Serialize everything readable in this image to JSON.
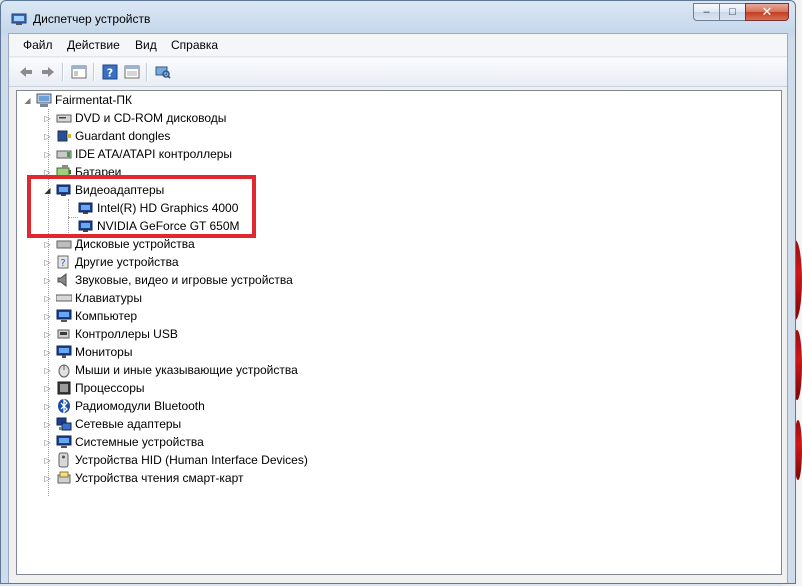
{
  "window": {
    "title": "Диспетчер устройств",
    "icon": "device-manager-icon",
    "caption_buttons": {
      "minimize": "–",
      "maximize": "□",
      "close": "✕"
    }
  },
  "menu": {
    "items": [
      "Файл",
      "Действие",
      "Вид",
      "Справка"
    ]
  },
  "toolbar": {
    "buttons": [
      "back-arrow-icon",
      "forward-arrow-icon",
      "properties-pane-icon",
      "help-icon",
      "show-hide-console-tree-icon",
      "scan-hardware-icon"
    ]
  },
  "tree": {
    "root": {
      "label": "Fairmentat-ПК",
      "expanded": true
    },
    "categories": [
      {
        "label": "DVD и CD-ROM дисководы",
        "icon": "dvd-drive-icon",
        "expanded": false
      },
      {
        "label": "Guardant dongles",
        "icon": "dongle-icon",
        "expanded": false
      },
      {
        "label": "IDE ATA/ATAPI контроллеры",
        "icon": "ide-controller-icon",
        "expanded": false
      },
      {
        "label": "Батареи",
        "icon": "battery-icon",
        "expanded": false
      },
      {
        "label": "Видеоадаптеры",
        "icon": "display-adapter-icon",
        "expanded": true,
        "children": [
          {
            "label": "Intel(R) HD Graphics 4000",
            "icon": "display-adapter-icon"
          },
          {
            "label": "NVIDIA GeForce GT 650M",
            "icon": "display-adapter-icon"
          }
        ]
      },
      {
        "label": "Дисковые устройства",
        "icon": "disk-drive-icon",
        "expanded": false
      },
      {
        "label": "Другие устройства",
        "icon": "other-devices-icon",
        "expanded": false
      },
      {
        "label": "Звуковые, видео и игровые устройства",
        "icon": "speaker-icon",
        "expanded": false
      },
      {
        "label": "Клавиатуры",
        "icon": "keyboard-icon",
        "expanded": false
      },
      {
        "label": "Компьютер",
        "icon": "computer-icon",
        "expanded": false
      },
      {
        "label": "Контроллеры USB",
        "icon": "usb-controller-icon",
        "expanded": false
      },
      {
        "label": "Мониторы",
        "icon": "monitor-icon",
        "expanded": false
      },
      {
        "label": "Мыши и иные указывающие устройства",
        "icon": "mouse-icon",
        "expanded": false
      },
      {
        "label": "Процессоры",
        "icon": "processor-icon",
        "expanded": false
      },
      {
        "label": "Радиомодули Bluetooth",
        "icon": "bluetooth-icon",
        "expanded": false
      },
      {
        "label": "Сетевые адаптеры",
        "icon": "network-adapter-icon",
        "expanded": false
      },
      {
        "label": "Системные устройства",
        "icon": "system-devices-icon",
        "expanded": false
      },
      {
        "label": "Устройства HID (Human Interface Devices)",
        "icon": "hid-icon",
        "expanded": false
      },
      {
        "label": "Устройства чтения смарт-карт",
        "icon": "smart-card-reader-icon",
        "expanded": false
      }
    ]
  },
  "annotation": {
    "color": "#e0282e"
  }
}
